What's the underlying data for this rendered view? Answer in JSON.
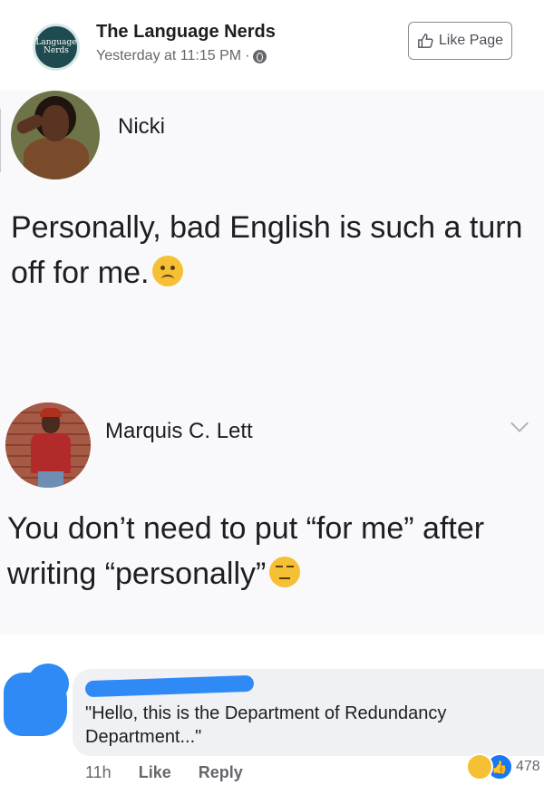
{
  "post_header": {
    "logo_text_line1": "Language",
    "logo_text_line2": "Nerds",
    "page_name": "The Language Nerds",
    "timestamp": "Yesterday at 11:15 PM",
    "separator": "·",
    "audience_icon": "globe-icon",
    "like_page_label": "Like Page"
  },
  "screenshot": {
    "comment1": {
      "author": "Nicki",
      "text": "Personally, bad English is such a turn off for me.",
      "emoji": "frowning-face-emoji"
    },
    "comment2": {
      "author": "Marquis C. Lett",
      "text": "You don’t need to put “for me” after writing “personally”",
      "emoji": "unamused-face-emoji"
    }
  },
  "reply": {
    "text": "\"Hello, this is the Department of Redundancy Department...\"",
    "time": "11h",
    "like_label": "Like",
    "reply_label": "Reply",
    "reaction_count": "478"
  },
  "colors": {
    "accent": "#1877f2",
    "redaction": "#2f8af5",
    "muted_text": "#65676b"
  }
}
